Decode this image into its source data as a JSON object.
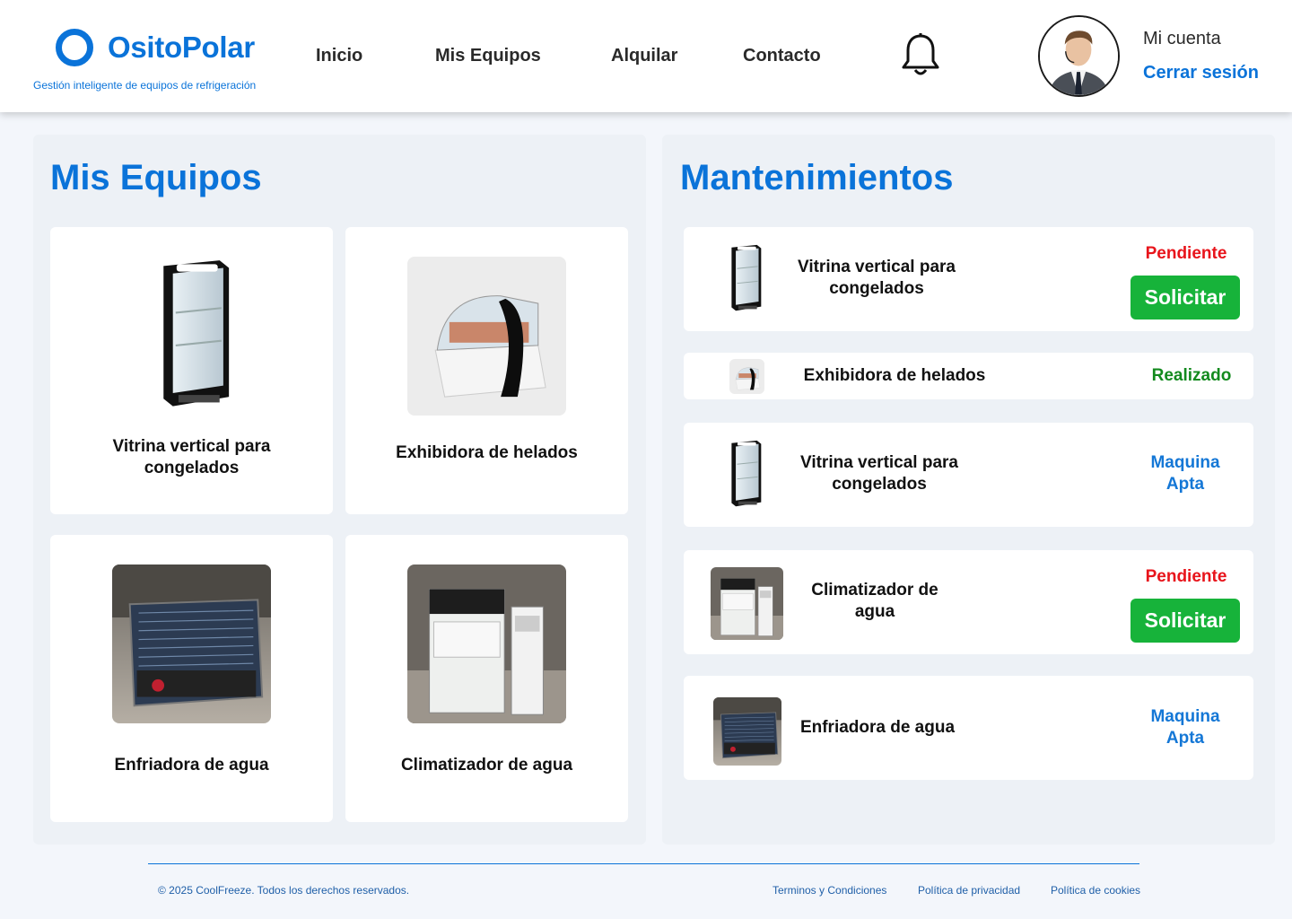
{
  "brand": {
    "name": "OsitoPolar",
    "tagline": "Gestión inteligente de equipos de refrigeración",
    "color": "#0a73d9"
  },
  "nav": {
    "items": [
      {
        "label": "Inicio"
      },
      {
        "label": "Mis Equipos"
      },
      {
        "label": "Alquilar"
      },
      {
        "label": "Contacto"
      }
    ],
    "notification_icon": "bell-icon"
  },
  "account": {
    "label": "Mi cuenta",
    "logout": "Cerrar sesión"
  },
  "equipos": {
    "title": "Mis Equipos",
    "items": [
      {
        "name": "Vitrina vertical para congelados",
        "image": "freezer-display-image"
      },
      {
        "name": "Exhibidora de helados",
        "image": "ice-cream-display-image"
      },
      {
        "name": "Enfriadora de agua",
        "image": "water-chiller-image"
      },
      {
        "name": "Climatizador de agua",
        "image": "air-conditioner-image"
      }
    ]
  },
  "mantenimientos": {
    "title": "Mantenimientos",
    "items": [
      {
        "name": "Vitrina vertical para congelados",
        "status": "Pendiente",
        "status_type": "pending",
        "action": "Solicitar"
      },
      {
        "name": "Exhibidora de helados",
        "status": "Realizado",
        "status_type": "done"
      },
      {
        "name": "Vitrina vertical para congelados",
        "status": "Maquina Apta",
        "status_type": "apta"
      },
      {
        "name": "Climatizador de agua",
        "status": "Pendiente",
        "status_type": "pending",
        "action": "Solicitar"
      },
      {
        "name": "Enfriadora de agua",
        "status": "Maquina Apta",
        "status_type": "apta"
      }
    ],
    "status_colors": {
      "pending": "#e8141b",
      "done": "#138a1e",
      "apta": "#1477d6",
      "button": "#17b33a"
    }
  },
  "footer": {
    "copyright": "© 2025 CoolFreeze. Todos los derechos reservados.",
    "links": [
      "Terminos y Condiciones",
      "Política de privacidad",
      "Política de cookies"
    ]
  }
}
